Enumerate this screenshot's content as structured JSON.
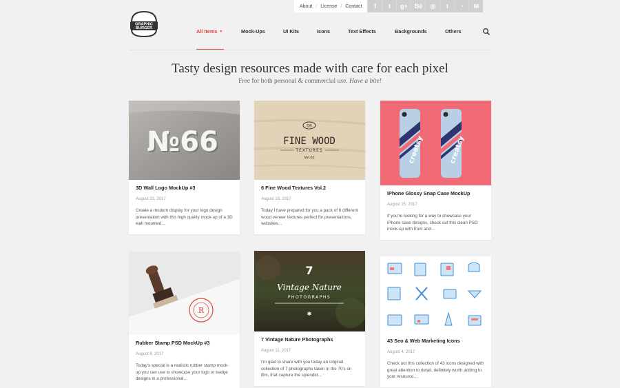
{
  "top_links": [
    "About",
    "License",
    "Contact"
  ],
  "social_icons": [
    "facebook-icon",
    "twitter-icon",
    "google-plus-icon",
    "behance-icon",
    "dribbble-icon",
    "tumblr-icon",
    "rss-icon",
    "email-icon"
  ],
  "social_glyphs": [
    "f",
    "t",
    "g+",
    "Bē",
    "◎",
    "t",
    "◔",
    "✉"
  ],
  "logo": {
    "line1": "GRAPHIC",
    "line2": "BURGER"
  },
  "nav": {
    "items": [
      "All Items",
      "Mock-Ups",
      "UI Kits",
      "Icons",
      "Text Effects",
      "Backgrounds",
      "Others"
    ],
    "active_index": 0
  },
  "hero": {
    "title": "Tasty design resources made with care for each pixel",
    "subtitle": "Free for both personal & commercial use.",
    "subtitle_em": "Have a bite!"
  },
  "colors": {
    "accent": "#e2463f",
    "background": "#f1f1f1"
  },
  "cards": [
    {
      "title": "3D Wall Logo MockUp #3",
      "date": "August 23, 2017",
      "desc": "Create a modern display for your logo design presentation with this high quality mock-up of a 3D wall mounted…",
      "thumb_text": "№66"
    },
    {
      "title": "6 Fine Wood Textures Vol.2",
      "date": "August 18, 2017",
      "desc": "Today I have prepared for you a pack of 6 different wood veneer textures perfect for presentations, websites…",
      "thumb_text": {
        "num": "06",
        "main": "FINE WOOD",
        "sub": "TEXTURES",
        "vol": "Vol.02"
      }
    },
    {
      "title": "iPhone Glossy Snap Case MockUp",
      "date": "August 15, 2017",
      "desc": "If you're looking for a way to showcase your iPhone case designs, check out this clean PSD mock-up with front and…",
      "thumb_text": "creatsy"
    },
    {
      "title": "Rubber Stamp PSD MockUp #3",
      "date": "August 8, 2017",
      "desc": "Today's special is a realistic rubber stamp mock-up you can use to showcase your logo or badge designs in a professional…",
      "thumb_text": "R"
    },
    {
      "title": "7 Vintage Nature Photographs",
      "date": "August 11, 2017",
      "desc": "I'm glad to share with you today an original collection of 7 photographs taken in the 70's on film, that capture the splendid…",
      "thumb_text": {
        "num": "7",
        "main": "Vintage Nature",
        "sub": "PHOTOGRAPHS"
      }
    },
    {
      "title": "43 Seo & Web Marketing Icons",
      "date": "August 4, 2017",
      "desc": "Check out this collection of 43 icons designed with great attention to detail, definitely worth adding to your resource…"
    }
  ]
}
